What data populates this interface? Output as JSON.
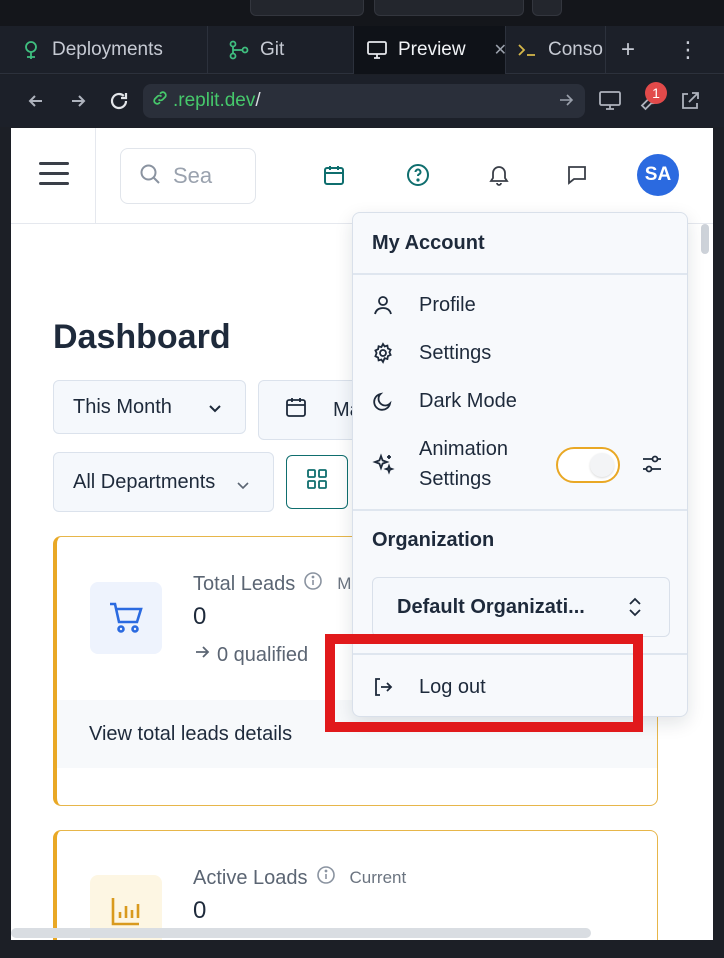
{
  "browser": {
    "tabs": [
      {
        "label": "Deployments",
        "icon": "deployments-icon"
      },
      {
        "label": "Git",
        "icon": "git-icon"
      },
      {
        "label": "Preview",
        "icon": "monitor-icon",
        "active": true
      },
      {
        "label": "Conso",
        "icon": "terminal-icon"
      }
    ],
    "url_host": ".replit.dev",
    "url_path": "/",
    "devtools_badge": "1"
  },
  "header": {
    "search_placeholder": "Search",
    "avatar_initials": "SA"
  },
  "page": {
    "title": "Dashboard",
    "filters": {
      "period": "This Month",
      "date_partial": "Ma",
      "department": "All Departments"
    },
    "cards": [
      {
        "label": "Total Leads",
        "label_suffix": "M",
        "value": "0",
        "sub": "0 qualified",
        "footer": "View total leads details"
      },
      {
        "label": "Active Loads",
        "tag": "Current",
        "value": "0"
      }
    ]
  },
  "account_menu": {
    "heading": "My Account",
    "items": [
      "Profile",
      "Settings",
      "Dark Mode"
    ],
    "animation_label_line1": "Animation",
    "animation_label_line2": "Settings",
    "animation_enabled": true,
    "org_heading": "Organization",
    "org_selected": "Default Organizati...",
    "logout": "Log out"
  },
  "colors": {
    "accent_blue": "#2b6ae0",
    "accent_teal": "#0f6e6e",
    "card_border": "#e9a825",
    "highlight": "#e1191b",
    "url_green": "#46c86b"
  }
}
